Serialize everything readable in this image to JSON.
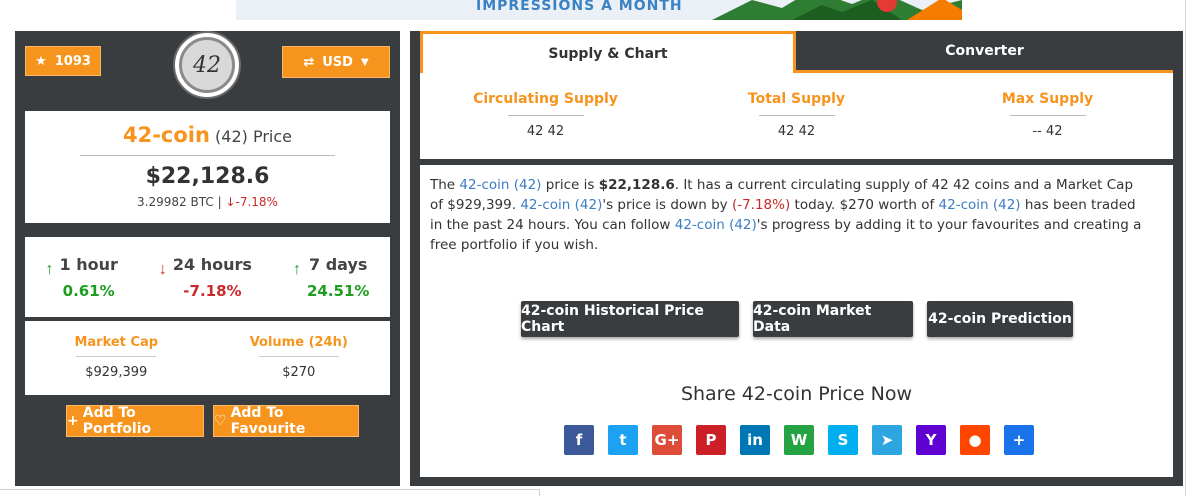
{
  "banner": {
    "text": "IMPRESSIONS A MONTH"
  },
  "left": {
    "rank_value": "1093",
    "rank_icon": "star-icon",
    "logo_text": "42",
    "currency_label": "USD",
    "price_card": {
      "coin_name": "42-coin",
      "ticker": "(42)",
      "price_word": "Price",
      "price": "$22,128.6",
      "btc_value": "3.29982 BTC",
      "separator": "|",
      "change_24h": "-7.18%"
    },
    "changes": [
      {
        "label": "1 hour",
        "value": "0.61%",
        "direction": "up"
      },
      {
        "label": "24 hours",
        "value": "-7.18%",
        "direction": "down"
      },
      {
        "label": "7 days",
        "value": "24.51%",
        "direction": "up"
      }
    ],
    "market_cap_label": "Market Cap",
    "market_cap_value": "$929,399",
    "volume_label": "Volume (24h)",
    "volume_value": "$270",
    "add_portfolio_label": "Add To Portfolio",
    "add_favourite_label": "Add To Favourite"
  },
  "right": {
    "tabs": [
      {
        "label": "Supply & Chart",
        "active": true
      },
      {
        "label": "Converter",
        "active": false
      }
    ],
    "supply": [
      {
        "label": "Circulating Supply",
        "value": "42 42"
      },
      {
        "label": "Total Supply",
        "value": "42 42"
      },
      {
        "label": "Max Supply",
        "value": "-- 42"
      }
    ],
    "description": {
      "p1": "The ",
      "link1": "42-coin (42)",
      "p2": " price is ",
      "price": "$22,128.6",
      "p3": ". It has a current circulating supply of 42 42 coins and a Market Cap of $929,399. ",
      "link2": "42-coin (42)",
      "p4": "'s price is down by ",
      "change": "(-7.18%)",
      "p5": " today. $270 worth of ",
      "link3": "42-coin (42)",
      "p6": " has been traded in the past 24 hours. You can follow ",
      "link4": "42-coin (42)",
      "p7": "'s progress by adding it to your favourites and creating a free portfolio if you wish."
    },
    "buttons": {
      "historical": "42-coin Historical Price Chart",
      "market": "42-coin Market Data",
      "prediction": "42-coin Prediction"
    },
    "share_title": "Share 42-coin Price Now",
    "share": [
      {
        "name": "facebook-icon",
        "glyph": "f",
        "color": "#3b5998"
      },
      {
        "name": "twitter-icon",
        "glyph": "t",
        "color": "#1da1f2"
      },
      {
        "name": "google-plus-icon",
        "glyph": "G+",
        "color": "#dd4b39"
      },
      {
        "name": "pinterest-icon",
        "glyph": "P",
        "color": "#cb2027"
      },
      {
        "name": "linkedin-icon",
        "glyph": "in",
        "color": "#0077b5"
      },
      {
        "name": "whatsapp-icon",
        "glyph": "W",
        "color": "#25a244"
      },
      {
        "name": "skype-icon",
        "glyph": "S",
        "color": "#00aff0"
      },
      {
        "name": "telegram-icon",
        "glyph": "➤",
        "color": "#2ca5e0"
      },
      {
        "name": "yahoo-icon",
        "glyph": "Y",
        "color": "#5f01d1"
      },
      {
        "name": "reddit-icon",
        "glyph": "●",
        "color": "#ff4500"
      },
      {
        "name": "more-share-icon",
        "glyph": "+",
        "color": "#1a73e8"
      }
    ]
  }
}
